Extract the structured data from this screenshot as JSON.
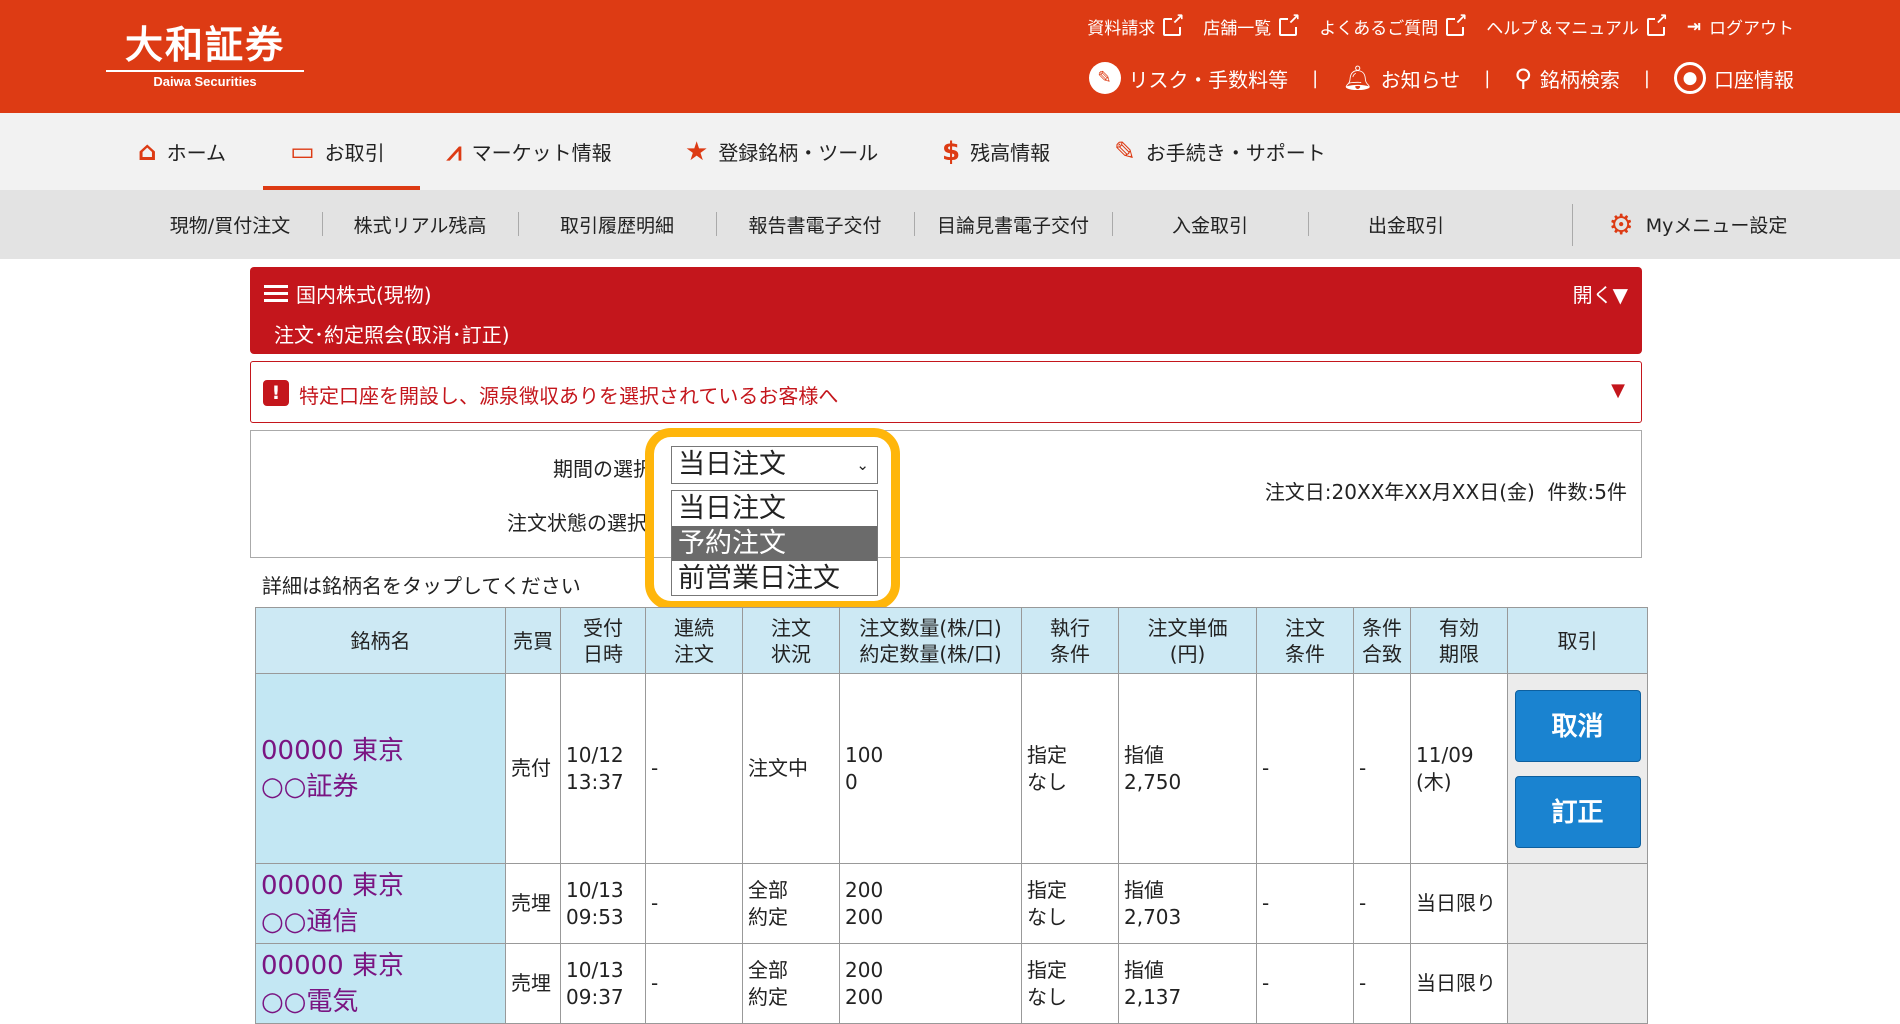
{
  "header": {
    "logo_jp": "大和証券",
    "logo_en": "Daiwa Securities",
    "top_links": [
      "資料請求",
      "店舗一覧",
      "よくあるご質問",
      "ヘルプ＆マニュアル"
    ],
    "logout": "ログアウト",
    "second_links": [
      "リスク・手数料等",
      "お知らせ",
      "銘柄検索",
      "口座情報"
    ]
  },
  "main_nav": [
    "ホーム",
    "お取引",
    "マーケット情報",
    "登録銘柄・ツール",
    "残高情報",
    "お手続き・サポート"
  ],
  "sub_nav": [
    "現物/買付注文",
    "株式リアル残高",
    "取引履歴明細",
    "報告書電子交付",
    "目論見書電子交付",
    "入金取引",
    "出金取引",
    "Myメニュー設定"
  ],
  "panel": {
    "category": "国内株式(現物)",
    "title": "注文･約定照会(取消･訂正)",
    "open": "開く▼"
  },
  "alert": {
    "text": "特定口座を開設し、源泉徴収ありを選択されているお客様へ",
    "arrow": "▼"
  },
  "filter": {
    "period_label": "期間の選択",
    "status_label": "注文状態の選択",
    "selected": "当日注文",
    "options": [
      "当日注文",
      "予約注文",
      "前営業日注文"
    ],
    "highlighted_option": "予約注文",
    "order_date": "注文日:20XX年XX月XX日(金)",
    "count": "件数:5件"
  },
  "hint": "詳細は銘柄名をタップしてください",
  "table": {
    "headers": [
      [
        "銘柄名"
      ],
      [
        "売買"
      ],
      [
        "受付",
        "日時"
      ],
      [
        "連続",
        "注文"
      ],
      [
        "注文",
        "状況"
      ],
      [
        "注文数量(株/口)",
        "約定数量(株/口)"
      ],
      [
        "執行",
        "条件"
      ],
      [
        "注文単価",
        "(円)"
      ],
      [
        "注文",
        "条件"
      ],
      [
        "条件",
        "合致"
      ],
      [
        "有効",
        "期限"
      ],
      [
        "取引"
      ]
    ],
    "rows": [
      {
        "name1": "00000 東京",
        "name2": "○○証券",
        "side": "売付",
        "d1": "10/12",
        "d2": "13:37",
        "cont": "-",
        "st1": "注文中",
        "st2": "",
        "q1": "100",
        "q2": "0",
        "ex1": "指定",
        "ex2": "なし",
        "p1": "指値",
        "p2": "2,750",
        "cond": "-",
        "match": "-",
        "exp1": "11/09",
        "exp2": "(木)",
        "cancel": "取消",
        "modify": "訂正"
      },
      {
        "name1": "00000 東京",
        "name2": "○○通信",
        "side": "売埋",
        "d1": "10/13",
        "d2": "09:53",
        "cont": "-",
        "st1": "全部",
        "st2": "約定",
        "q1": "200",
        "q2": "200",
        "ex1": "指定",
        "ex2": "なし",
        "p1": "指値",
        "p2": "2,703",
        "cond": "-",
        "match": "-",
        "exp1": "当日限り",
        "exp2": ""
      },
      {
        "name1": "00000 東京",
        "name2": "○○電気",
        "side": "売埋",
        "d1": "10/13",
        "d2": "09:37",
        "cont": "-",
        "st1": "全部",
        "st2": "約定",
        "q1": "200",
        "q2": "200",
        "ex1": "指定",
        "ex2": "なし",
        "p1": "指値",
        "p2": "2,137",
        "cond": "-",
        "match": "-",
        "exp1": "当日限り",
        "exp2": ""
      }
    ]
  },
  "colors": {
    "brand": "#dd3b14",
    "panel": "#c4161c",
    "highlight": "#ffb60b",
    "button": "#1a83d0"
  }
}
